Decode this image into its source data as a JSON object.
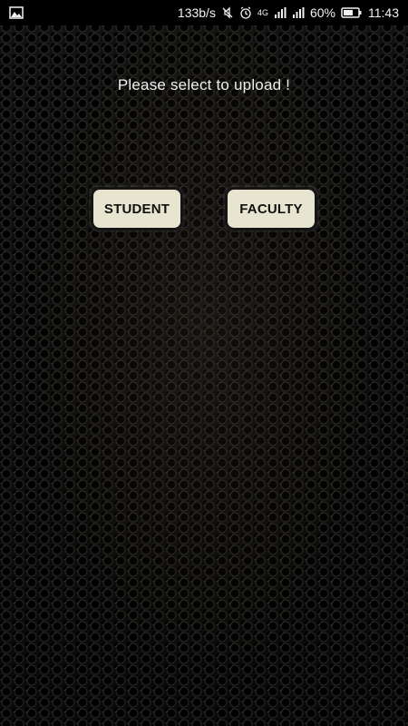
{
  "status_bar": {
    "network_speed": "133b/s",
    "network_type": "4G",
    "battery_percent": "60%",
    "time": "11:43",
    "icons": [
      "image-icon",
      "silent-icon",
      "alarm-icon",
      "signal-icon",
      "signal-bars-icon",
      "battery-icon"
    ]
  },
  "main": {
    "prompt": "Please select to upload !",
    "buttons": [
      {
        "label": "STUDENT"
      },
      {
        "label": "FACULTY"
      }
    ]
  },
  "colors": {
    "background": "#0b0b0b",
    "button": "#e7e4cf",
    "text": "#efefef"
  }
}
